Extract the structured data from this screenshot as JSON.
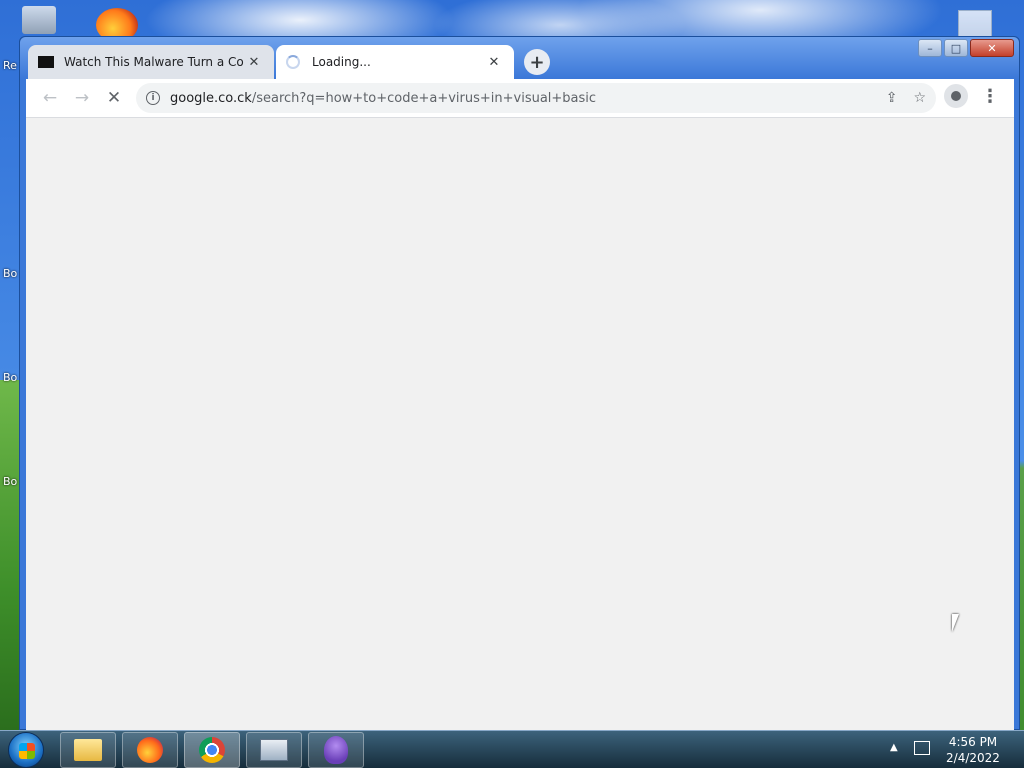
{
  "desktop": {
    "labels": [
      "Re",
      "Bo",
      "Bo",
      "Bo"
    ]
  },
  "browser": {
    "tabs": [
      {
        "title": "Watch This Malware Turn a Comp",
        "state": "inactive"
      },
      {
        "title": "Loading...",
        "state": "active-loading"
      }
    ],
    "new_tab_symbol": "+",
    "address": {
      "domain": "google.co.ck",
      "path": "/search?q=how+to+code+a+virus+in+visual+basic"
    },
    "window_controls": {
      "minimize": "–",
      "maximize": "□",
      "close": "✕"
    }
  },
  "taskbar": {
    "apps": [
      "file-explorer-icon",
      "firefox-icon",
      "chrome-icon",
      "system-monitor-icon",
      "bonzi-buddy-icon"
    ],
    "time": "4:56 PM",
    "date": "2/4/2022"
  }
}
